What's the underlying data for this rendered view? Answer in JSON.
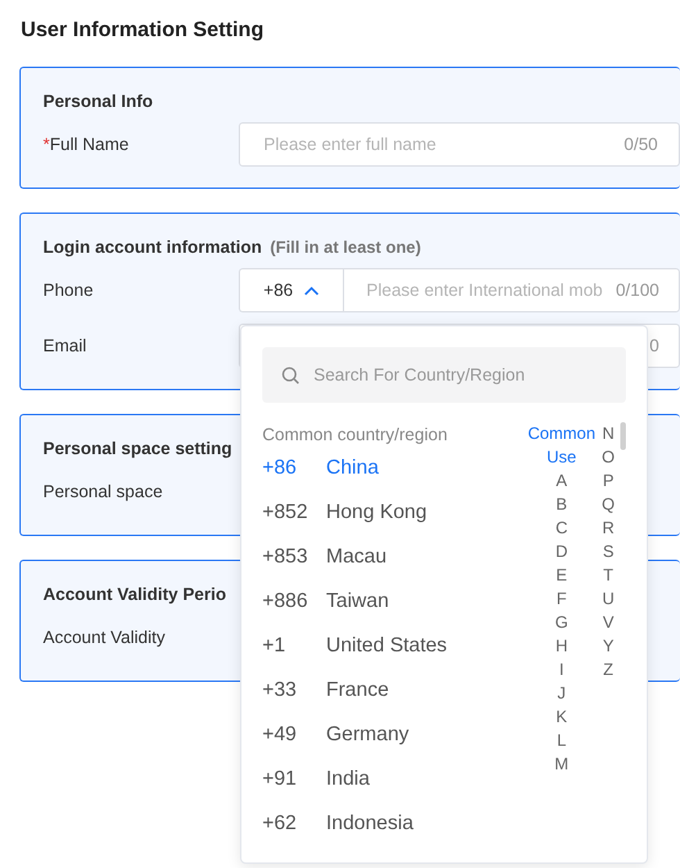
{
  "page_title": "User Information Setting",
  "sections": [
    {
      "title": "Personal Info",
      "rows": [
        {
          "kind": "text",
          "label": "Full Name",
          "mark": "*",
          "placeholder": "Please enter full name",
          "counter": "0/50"
        }
      ]
    },
    {
      "title": "Login account information",
      "note": "(Fill in at least one)",
      "rows": [
        {
          "kind": "phone",
          "label": "Phone",
          "code": "+86",
          "expanded": true,
          "placeholder": "Please enter International mob",
          "counter": "0/100"
        },
        {
          "kind": "covered",
          "label": "Email",
          "counter": "0"
        }
      ]
    },
    {
      "title": "Personal space setting",
      "rows": [
        {
          "kind": "hidden",
          "label": "Personal space"
        }
      ]
    },
    {
      "title": "Account Validity Perio",
      "rows": [
        {
          "kind": "hidden",
          "label": "Account Validity"
        }
      ]
    }
  ],
  "dropdown": {
    "search_placeholder": "Search For Country/Region",
    "section_label": "Common country/region",
    "countries": [
      {
        "code": "+86",
        "name": "China",
        "selected": true
      },
      {
        "code": "+852",
        "name": "Hong Kong",
        "selected": false
      },
      {
        "code": "+853",
        "name": "Macau",
        "selected": false
      },
      {
        "code": "+886",
        "name": "Taiwan",
        "selected": false
      },
      {
        "code": "+1",
        "name": "United States",
        "selected": false
      },
      {
        "code": "+33",
        "name": "France",
        "selected": false
      },
      {
        "code": "+49",
        "name": "Germany",
        "selected": false
      },
      {
        "code": "+91",
        "name": "India",
        "selected": false
      },
      {
        "code": "+62",
        "name": "Indonesia",
        "selected": false
      }
    ],
    "index_columns": [
      [
        {
          "label": "Common Use",
          "selected": true
        },
        {
          "label": "A",
          "selected": false
        },
        {
          "label": "B",
          "selected": false
        },
        {
          "label": "C",
          "selected": false
        },
        {
          "label": "D",
          "selected": false
        },
        {
          "label": "E",
          "selected": false
        },
        {
          "label": "F",
          "selected": false
        },
        {
          "label": "G",
          "selected": false
        },
        {
          "label": "H",
          "selected": false
        },
        {
          "label": "I",
          "selected": false
        },
        {
          "label": "J",
          "selected": false
        },
        {
          "label": "K",
          "selected": false
        },
        {
          "label": "L",
          "selected": false
        },
        {
          "label": "M",
          "selected": false
        }
      ],
      [
        {
          "label": "N",
          "selected": false
        },
        {
          "label": "O",
          "selected": false
        },
        {
          "label": "P",
          "selected": false
        },
        {
          "label": "Q",
          "selected": false
        },
        {
          "label": "R",
          "selected": false
        },
        {
          "label": "S",
          "selected": false
        },
        {
          "label": "T",
          "selected": false
        },
        {
          "label": "U",
          "selected": false
        },
        {
          "label": "V",
          "selected": false
        },
        {
          "label": "Y",
          "selected": false
        },
        {
          "label": "Z",
          "selected": false
        }
      ]
    ]
  }
}
